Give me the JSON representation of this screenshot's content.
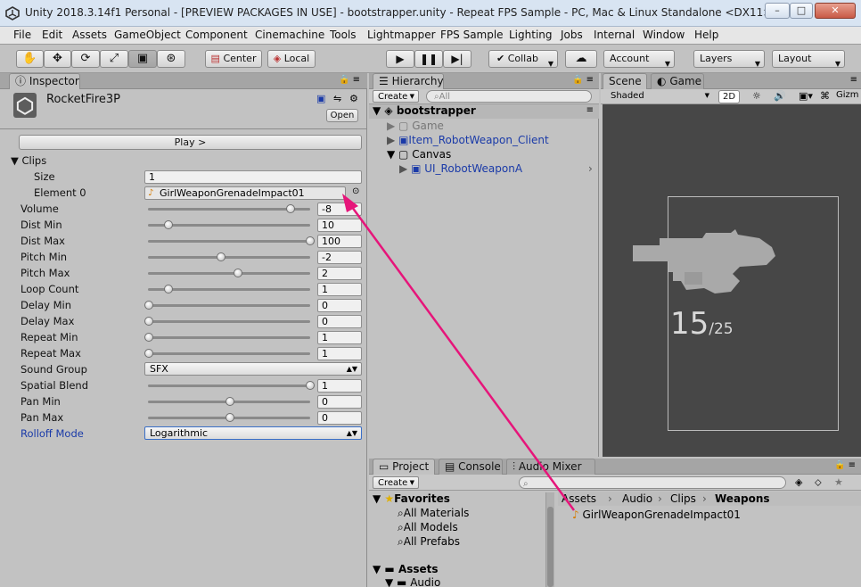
{
  "window": {
    "title": "Unity 2018.3.14f1 Personal - [PREVIEW PACKAGES IN USE] - bootstrapper.unity - Repeat FPS Sample - PC, Mac & Linux Standalone <DX11>",
    "min_glyph": "–",
    "max_glyph": "□",
    "close_glyph": "✕"
  },
  "menu": [
    "File",
    "Edit",
    "Assets",
    "GameObject",
    "Component",
    "Cinemachine",
    "Tools",
    "Lightmapper",
    "FPS Sample",
    "Lighting",
    "Jobs",
    "Internal",
    "Window",
    "Help"
  ],
  "toolbar": {
    "tools": [
      "hand-icon",
      "move-icon",
      "rotate-icon",
      "scale-icon",
      "rect-icon",
      "transform-icon"
    ],
    "pivot": "Center",
    "space": "Local",
    "collab": "Collab",
    "account": "Account",
    "layers": "Layers",
    "layout": "Layout"
  },
  "inspector": {
    "tab": "Inspector",
    "object_name": "RocketFire3P",
    "open_label": "Open",
    "play_label": "Play >",
    "clips_label": "Clips",
    "size_label": "Size",
    "size_value": "1",
    "element0_label": "Element 0",
    "element0_value": "GirlWeaponGrenadeImpact01",
    "rows": [
      {
        "label": "Volume",
        "value": "-8",
        "slider": 0.88
      },
      {
        "label": "Dist Min",
        "value": "10",
        "slider": 0.12
      },
      {
        "label": "Dist Max",
        "value": "100",
        "slider": 1.0
      },
      {
        "label": "Pitch Min",
        "value": "-2",
        "slider": 0.45
      },
      {
        "label": "Pitch Max",
        "value": "2",
        "slider": 0.55
      },
      {
        "label": "Loop Count",
        "value": "1",
        "slider": 0.12
      },
      {
        "label": "Delay Min",
        "value": "0",
        "slider": 0.0
      },
      {
        "label": "Delay Max",
        "value": "0",
        "slider": 0.0
      },
      {
        "label": "Repeat Min",
        "value": "1",
        "slider": 0.0
      },
      {
        "label": "Repeat Max",
        "value": "1",
        "slider": 0.0
      }
    ],
    "sound_group_label": "Sound Group",
    "sound_group_value": "SFX",
    "rows2": [
      {
        "label": "Spatial Blend",
        "value": "1",
        "slider": 1.0
      },
      {
        "label": "Pan Min",
        "value": "0",
        "slider": 0.5
      },
      {
        "label": "Pan Max",
        "value": "0",
        "slider": 0.5
      }
    ],
    "rolloff_label": "Rolloff Mode",
    "rolloff_value": "Logarithmic"
  },
  "hierarchy": {
    "tab": "Hierarchy",
    "create": "Create",
    "search_placeholder": "All",
    "scene": "bootstrapper",
    "items": [
      "Game",
      "Item_RobotWeapon_Client",
      "Canvas",
      "UI_RobotWeaponA"
    ]
  },
  "scene": {
    "tab_scene": "Scene",
    "tab_game": "Game",
    "shading": "Shaded",
    "mode2d": "2D",
    "gizmos": "Gizm",
    "ammo_current": "15",
    "ammo_total": "/25"
  },
  "project": {
    "tab_project": "Project",
    "tab_console": "Console",
    "tab_mixer": "Audio Mixer",
    "create": "Create",
    "favorites": "Favorites",
    "fav_items": [
      "All Materials",
      "All Models",
      "All Prefabs"
    ],
    "assets": "Assets",
    "audio": "Audio",
    "breadcrumb": [
      "Assets",
      "Audio",
      "Clips",
      "Weapons"
    ],
    "asset_file": "GirlWeaponGrenadeImpact01"
  },
  "colors": {
    "arrow": "#e6157a",
    "accent_blue": "#1a3aa8"
  }
}
